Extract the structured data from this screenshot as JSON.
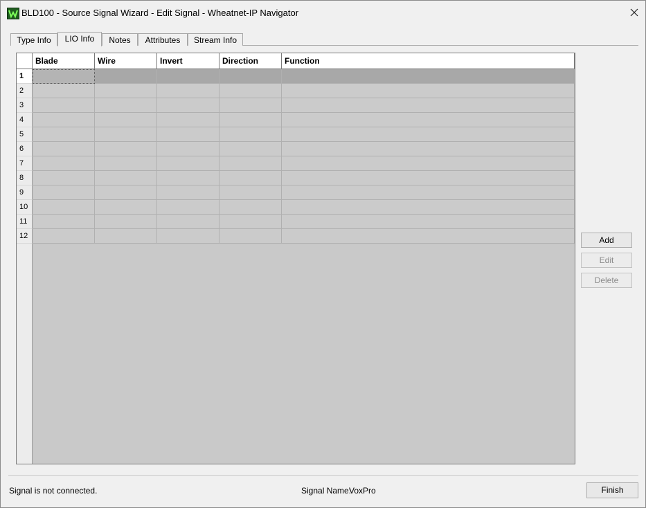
{
  "window": {
    "title": "BLD100 - Source Signal Wizard - Edit Signal - Wheatnet-IP Navigator",
    "app_icon": "wheatnet-w-icon",
    "close_icon": "close-icon"
  },
  "tabs": [
    {
      "label": "Type Info",
      "active": false
    },
    {
      "label": "LIO Info",
      "active": true
    },
    {
      "label": "Notes",
      "active": false
    },
    {
      "label": "Attributes",
      "active": false
    },
    {
      "label": "Stream Info",
      "active": false
    }
  ],
  "grid": {
    "columns": [
      "Blade",
      "Wire",
      "Invert",
      "Direction",
      "Function"
    ],
    "rows": [
      "1",
      "2",
      "3",
      "4",
      "5",
      "6",
      "7",
      "8",
      "9",
      "10",
      "11",
      "12"
    ],
    "selected_row": "1"
  },
  "buttons": {
    "add": "Add",
    "edit": "Edit",
    "delete": "Delete",
    "finish": "Finish"
  },
  "status": {
    "connection": "Signal is not connected.",
    "signal_name_label": "Signal Name:",
    "signal_name_value": "VoxPro"
  }
}
